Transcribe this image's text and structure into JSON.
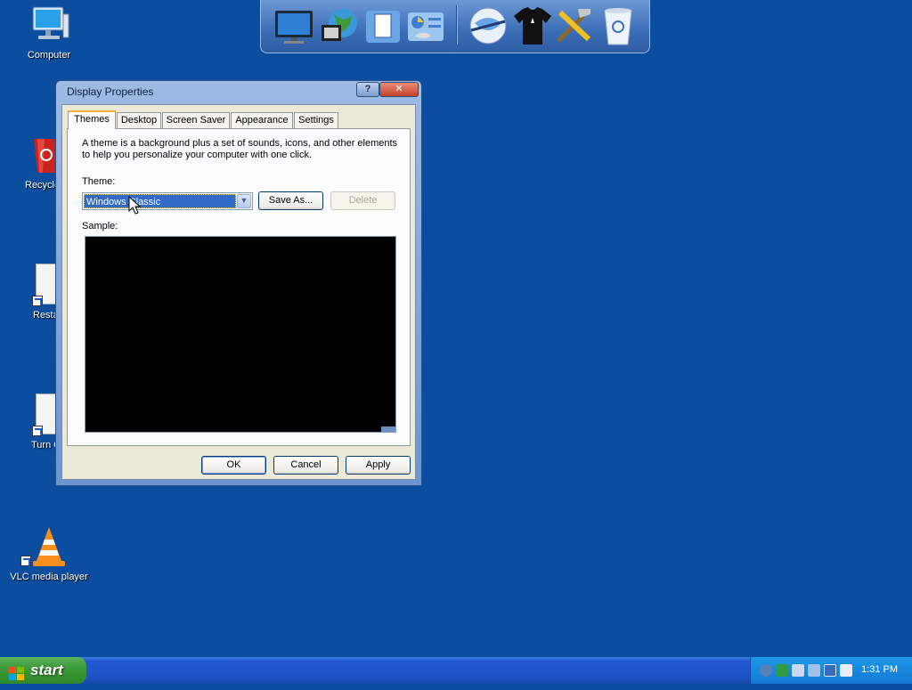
{
  "desktop": {
    "icons": [
      {
        "label": "Computer"
      },
      {
        "label": "Recycle"
      },
      {
        "label": "Resta"
      },
      {
        "label": "Turn O"
      },
      {
        "label": "VLC media player"
      }
    ]
  },
  "dock": {
    "items": [
      "monitor-icon",
      "globe-network-icon",
      "documents-icon",
      "control-panel-icon",
      "internet-globe-icon",
      "tshirt-icon",
      "tools-icon",
      "recycle-bin-icon"
    ]
  },
  "window": {
    "title": "Display Properties",
    "help_label": "?",
    "close_label": "✕",
    "tabs": [
      {
        "label": "Themes"
      },
      {
        "label": "Desktop"
      },
      {
        "label": "Screen Saver"
      },
      {
        "label": "Appearance"
      },
      {
        "label": "Settings"
      }
    ],
    "themes_panel": {
      "description": "A theme is a background plus a set of sounds, icons, and other elements to help you personalize your computer with one click.",
      "theme_label": "Theme:",
      "theme_value": "Windows Classic",
      "save_as_label": "Save As...",
      "delete_label": "Delete",
      "sample_label": "Sample:"
    },
    "footer": {
      "ok_label": "OK",
      "cancel_label": "Cancel",
      "apply_label": "Apply"
    }
  },
  "taskbar": {
    "start_label": "start",
    "clock": "1:31 PM"
  },
  "colors": {
    "desktop_bg": "#0b4d9e",
    "selection": "#316ac5",
    "taskbar": "#1f52c6",
    "start_green": "#3b9a38"
  }
}
